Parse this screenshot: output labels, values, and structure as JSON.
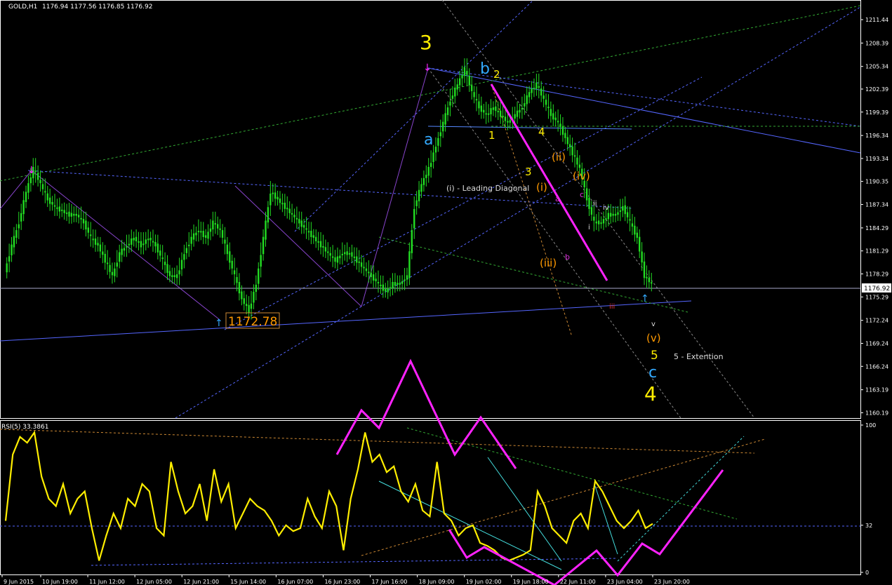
{
  "header": {
    "symbol": "GOLD,H1",
    "ohlc": "1176.94 1177.56 1176.85 1176.92",
    "rsi_label": "RSI(5) 33.3861"
  },
  "colors": {
    "background": "#000000",
    "candle": "#22dd22",
    "rsi_line": "#ffee00",
    "impulse_arrow": "#ff22ff",
    "wave_yellow": "#ffee00",
    "wave_orange": "#ff9900",
    "wave_blue": "#33aaff",
    "trend_line": "#5566ff",
    "channel_cyan": "#44dddd"
  },
  "chart_data": [
    {
      "type": "line",
      "title": "GOLD,H1",
      "ylim": [
        1159.5,
        1214.0
      ],
      "yticks": [
        "1211.44",
        "1208.39",
        "1205.34",
        "1202.39",
        "1199.39",
        "1196.34",
        "1193.34",
        "1190.35",
        "1187.34",
        "1184.29",
        "1181.29",
        "1178.29",
        "1175.29",
        "1172.24",
        "1169.24",
        "1166.24",
        "1163.19",
        "1160.19"
      ],
      "price_level": "1176.92",
      "low_marker": "1172.78",
      "xticks": [
        "9 Jun 2015",
        "10 Jun 19:00",
        "11 Jun 12:00",
        "12 Jun 05:00",
        "12 Jun 21:00",
        "15 Jun 14:00",
        "16 Jun 07:00",
        "16 Jun 23:00",
        "17 Jun 16:00",
        "18 Jun 09:00",
        "19 Jun 02:00",
        "19 Jun 18:00",
        "22 Jun 11:00",
        "23 Jun 04:00",
        "23 Jun 20:00"
      ],
      "series": [
        {
          "x": [
            0,
            3,
            6,
            9,
            12,
            15,
            18,
            21,
            24,
            27,
            30,
            33,
            36,
            39,
            42,
            45,
            48,
            51,
            54,
            57,
            60,
            63,
            66,
            69,
            72,
            75,
            78,
            81,
            84,
            87,
            90,
            93,
            96,
            99,
            102,
            105,
            108,
            111,
            114,
            117,
            120,
            123,
            126,
            129,
            132,
            135,
            138,
            141,
            144,
            147,
            150,
            153,
            156,
            159,
            162,
            165,
            168,
            171,
            174,
            177,
            180,
            183,
            186,
            189,
            192,
            195,
            198,
            201,
            204,
            207,
            210,
            213,
            216,
            219,
            222,
            225,
            228,
            231,
            234,
            237,
            240,
            243,
            246,
            249,
            252,
            255,
            258,
            261,
            264,
            267,
            270
          ],
          "values": [
            1178.5,
            1182,
            1185,
            1189,
            1192,
            1190,
            1188,
            1187,
            1186.5,
            1186,
            1186,
            1185,
            1183,
            1182,
            1180,
            1178,
            1181,
            1182,
            1183,
            1182,
            1183,
            1182,
            1180,
            1178,
            1178,
            1181,
            1183,
            1184,
            1183,
            1185,
            1184,
            1181,
            1178,
            1175,
            1173.5,
            1177,
            1183,
            1189,
            1188,
            1187,
            1186,
            1185,
            1184,
            1183,
            1182,
            1181,
            1180,
            1181,
            1181,
            1180,
            1179,
            1178,
            1177,
            1176,
            1177,
            1177,
            1178,
            1187,
            1190,
            1192,
            1195,
            1198,
            1201,
            1203,
            1205,
            1202,
            1200,
            1199,
            1200,
            1199,
            1198,
            1199,
            1200,
            1202,
            1203,
            1201,
            1199,
            1198,
            1196,
            1194,
            1192,
            1188,
            1185,
            1185,
            1186,
            1186,
            1187,
            1185,
            1183,
            1178,
            1177
          ]
        }
      ],
      "annotations": {
        "yellow_waves": [
          "3",
          "1",
          "2",
          "3",
          "4",
          "5",
          "4"
        ],
        "blue_waves": [
          "a",
          "b",
          "c"
        ],
        "orange_waves": [
          "(i)",
          "(ii)",
          "(iii)",
          "(iv)",
          "(v)"
        ],
        "small_waves": [
          "i",
          "ii",
          "iii",
          "iv",
          "v",
          "a",
          "b",
          "c"
        ],
        "text_notes": [
          "(i) - Leading Diagonal",
          "5 - Extention"
        ]
      }
    },
    {
      "type": "line",
      "title": "RSI(5) 33.3861",
      "ylim": [
        0,
        100
      ],
      "yticks": [
        "100",
        "32",
        "0"
      ],
      "series": [
        {
          "x": [
            0,
            3,
            6,
            9,
            12,
            15,
            18,
            21,
            24,
            27,
            30,
            33,
            36,
            39,
            42,
            45,
            48,
            51,
            54,
            57,
            60,
            63,
            66,
            69,
            72,
            75,
            78,
            81,
            84,
            87,
            90,
            93,
            96,
            99,
            102,
            105,
            108,
            111,
            114,
            117,
            120,
            123,
            126,
            129,
            132,
            135,
            138,
            141,
            144,
            147,
            150,
            153,
            156,
            159,
            162,
            165,
            168,
            171,
            174,
            177,
            180,
            183,
            186,
            189,
            192,
            195,
            198,
            201,
            204,
            207,
            210,
            213,
            216,
            219,
            222,
            225,
            228,
            231,
            234,
            237,
            240,
            243,
            246,
            249,
            252,
            255,
            258,
            261,
            264,
            267,
            270
          ],
          "values": [
            35,
            80,
            92,
            88,
            95,
            65,
            50,
            45,
            60,
            40,
            50,
            55,
            30,
            8,
            25,
            40,
            30,
            50,
            45,
            60,
            55,
            30,
            25,
            75,
            55,
            40,
            45,
            60,
            35,
            70,
            48,
            60,
            30,
            40,
            50,
            45,
            42,
            35,
            25,
            32,
            28,
            30,
            50,
            38,
            30,
            55,
            45,
            15,
            50,
            70,
            95,
            75,
            80,
            68,
            72,
            55,
            48,
            60,
            42,
            38,
            75,
            40,
            35,
            25,
            30,
            32,
            20,
            18,
            15,
            10,
            8,
            10,
            12,
            15,
            55,
            45,
            30,
            25,
            20,
            35,
            40,
            30,
            62,
            55,
            45,
            35,
            30,
            35,
            42,
            30,
            33
          ]
        }
      ]
    }
  ]
}
